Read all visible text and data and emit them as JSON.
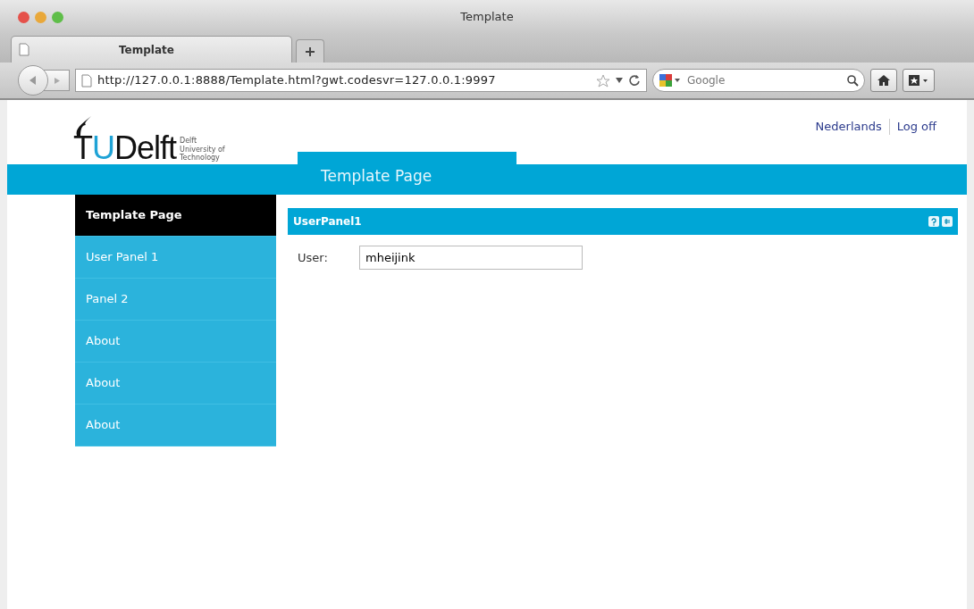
{
  "window": {
    "title": "Template"
  },
  "tabs": [
    {
      "label": "Template",
      "selected": true
    }
  ],
  "toolbar": {
    "url": "http://127.0.0.1:8888/Template.html?gwt.codesvr=127.0.0.1:9997",
    "search": {
      "placeholder": "Google"
    }
  },
  "page": {
    "logo": {
      "mark": "T",
      "accent": "U",
      "word": "Delft",
      "tagline": [
        "Delft",
        "University of",
        "Technology"
      ]
    },
    "top_links": [
      "Nederlands",
      "Log off"
    ],
    "header_tab": "Template Page",
    "sidebar": {
      "items": [
        {
          "label": "Template Page",
          "selected": true
        },
        {
          "label": "User Panel 1",
          "selected": false
        },
        {
          "label": "Panel 2",
          "selected": false
        },
        {
          "label": "About",
          "selected": false
        },
        {
          "label": "About",
          "selected": false
        },
        {
          "label": "About",
          "selected": false
        }
      ]
    },
    "panel": {
      "title": "UserPanel1",
      "fields": [
        {
          "label": "User:",
          "value": "mheijink"
        }
      ]
    }
  }
}
